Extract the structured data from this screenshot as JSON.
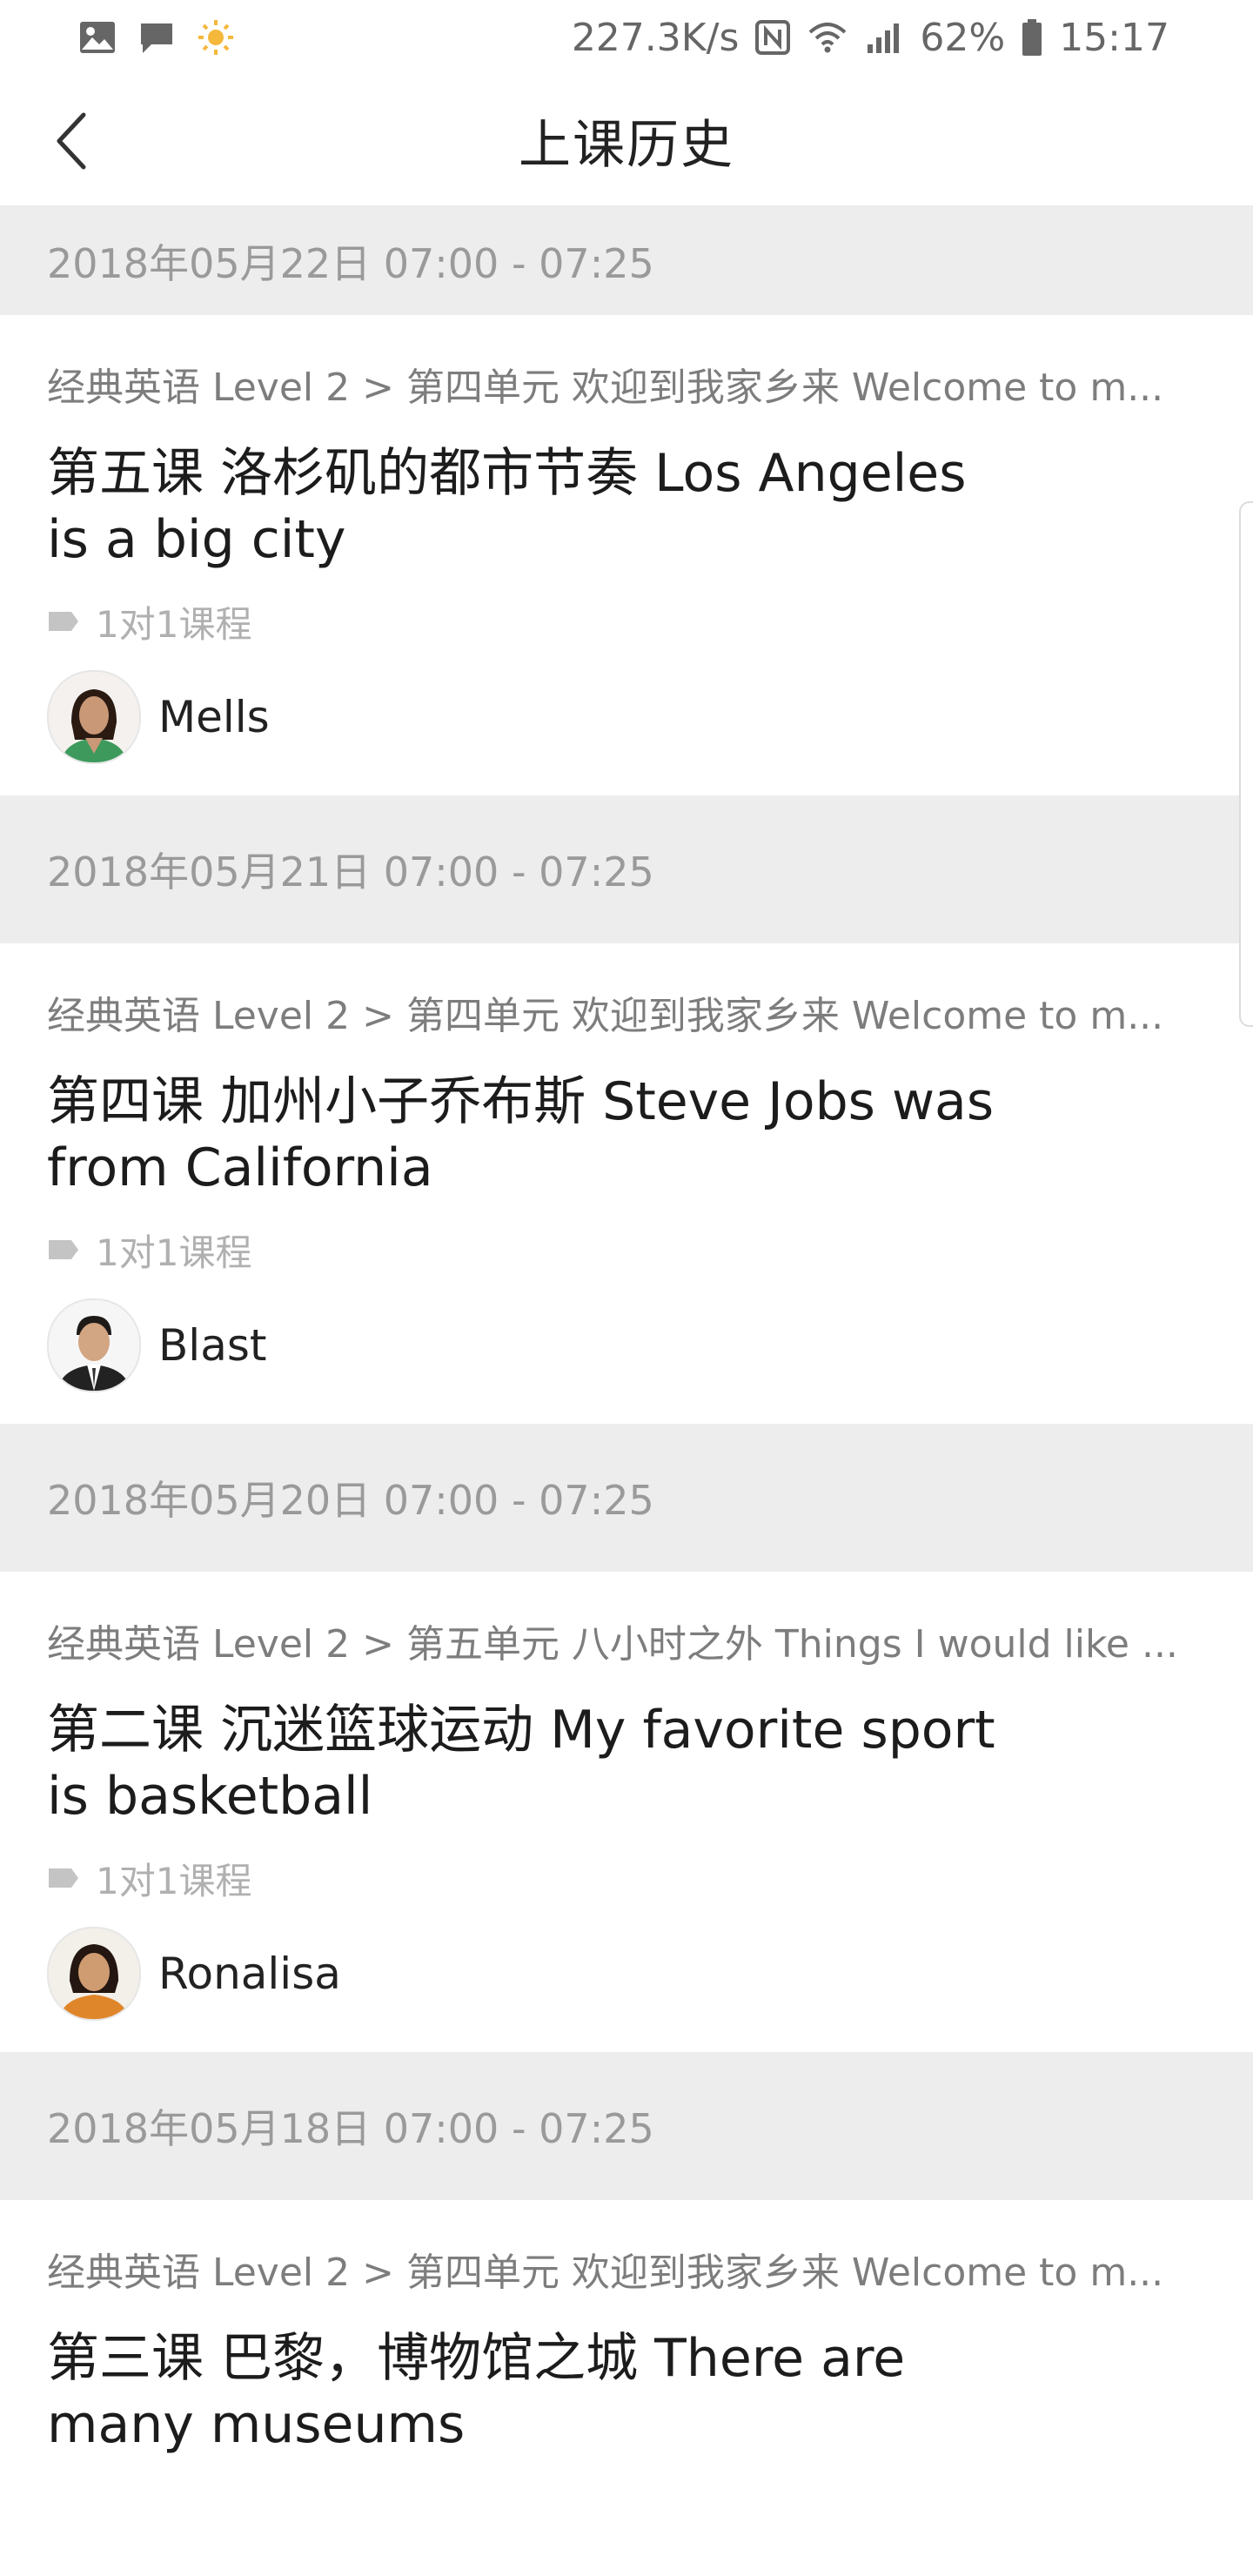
{
  "status_bar": {
    "speed": "227.3K/s",
    "battery": "62%",
    "time": "15:17",
    "icons": [
      "gallery-icon",
      "message-icon",
      "brightness-icon",
      "nfc-icon",
      "wifi-icon",
      "signal-icon",
      "battery-icon"
    ]
  },
  "header": {
    "title": "上课历史",
    "back_icon": "chevron-left-icon"
  },
  "sessions": [
    {
      "date": "2018年05月22日 07:00 - 07:25",
      "breadcrumb": "经典英语 Level 2 > 第四单元 欢迎到我家乡来 Welcome to m...",
      "lesson": "第五课 洛杉矶的都市节奏 Los Angeles is a big city",
      "tag": "1对1课程",
      "teacher": "Mells"
    },
    {
      "date": "2018年05月21日 07:00 - 07:25",
      "breadcrumb": "经典英语 Level 2 > 第四单元 欢迎到我家乡来 Welcome to m...",
      "lesson": "第四课 加州小子乔布斯 Steve Jobs was from California",
      "tag": "1对1课程",
      "teacher": "Blast"
    },
    {
      "date": "2018年05月20日 07:00 - 07:25",
      "breadcrumb": "经典英语 Level 2 > 第五单元 八小时之外 Things I would like ...",
      "lesson": "第二课 沉迷篮球运动 My favorite sport is basketball",
      "tag": "1对1课程",
      "teacher": "Ronalisa"
    },
    {
      "date": "2018年05月18日 07:00 - 07:25",
      "breadcrumb": "经典英语 Level 2 > 第四单元 欢迎到我家乡来 Welcome to m...",
      "lesson": "第三课 巴黎，博物馆之城 There are many museums",
      "tag": "",
      "teacher": ""
    }
  ],
  "colors": {
    "band": "#ededed",
    "muted": "#9a9a9a",
    "text": "#1c1c1c"
  }
}
